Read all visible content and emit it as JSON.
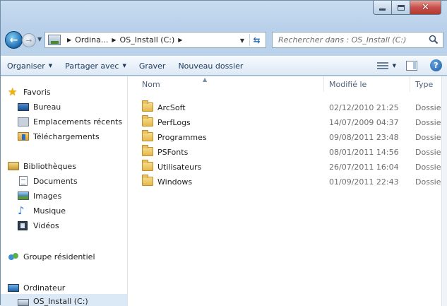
{
  "window": {
    "minimize_glyph": "",
    "maximize_glyph": "",
    "close_glyph": "✕"
  },
  "address_bar": {
    "crumbs": [
      "Ordina...",
      "OS_Install (C:)"
    ],
    "search_placeholder": "Rechercher dans : OS_Install (C:)"
  },
  "toolbar": {
    "organise": "Organiser",
    "share": "Partager avec",
    "burn": "Graver",
    "new_folder": "Nouveau dossier",
    "help": "?"
  },
  "nav": {
    "favorites": "Favoris",
    "bureau": "Bureau",
    "emplacements": "Emplacements récents",
    "telechargements": "Téléchargements",
    "libraries": "Bibliothèques",
    "documents": "Documents",
    "images": "Images",
    "musique": "Musique",
    "videos": "Vidéos",
    "homegroup": "Groupe résidentiel",
    "computer": "Ordinateur",
    "drive": "OS_Install (C:)"
  },
  "columns": {
    "name": "Nom",
    "modified": "Modifié le",
    "type": "Type"
  },
  "files": [
    {
      "name": "ArcSoft",
      "modified": "02/12/2010 21:25",
      "type": "Dossier"
    },
    {
      "name": "PerfLogs",
      "modified": "14/07/2009 04:37",
      "type": "Dossier"
    },
    {
      "name": "Programmes",
      "modified": "09/08/2011 23:48",
      "type": "Dossier"
    },
    {
      "name": "PSFonts",
      "modified": "08/01/2011 14:56",
      "type": "Dossier"
    },
    {
      "name": "Utilisateurs",
      "modified": "26/07/2011 16:04",
      "type": "Dossier"
    },
    {
      "name": "Windows",
      "modified": "01/09/2011 22:43",
      "type": "Dossier"
    }
  ]
}
